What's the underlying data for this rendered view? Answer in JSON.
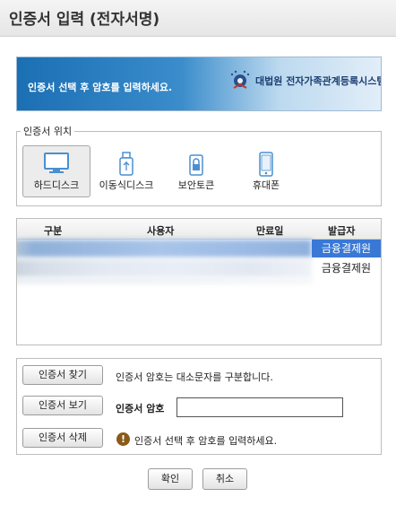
{
  "window": {
    "title": "인증서 입력 (전자서명)"
  },
  "banner": {
    "message": "인증서 선택 후 암호를 입력하세요.",
    "brand": "대법원 전자가족관계등록시스템"
  },
  "location": {
    "legend": "인증서 위치",
    "items": [
      {
        "label": "하드디스크",
        "icon": "monitor-icon",
        "selected": true
      },
      {
        "label": "이동식디스크",
        "icon": "usb-icon",
        "selected": false
      },
      {
        "label": "보안토큰",
        "icon": "lock-token-icon",
        "selected": false
      },
      {
        "label": "휴대폰",
        "icon": "phone-icon",
        "selected": false
      }
    ]
  },
  "table": {
    "headers": [
      "구분",
      "사용자",
      "만료일",
      "발급자"
    ],
    "rows": [
      {
        "issuer": "금융결제원",
        "selected": true
      },
      {
        "issuer": "금융결제원",
        "selected": false
      }
    ]
  },
  "actions": {
    "find": "인증서 찾기",
    "view": "인증서 보기",
    "delete": "인증서 삭제",
    "case_note": "인증서 암호는 대소문자를 구분합니다.",
    "password_label": "인증서 암호",
    "password_value": "",
    "hint": "인증서 선택 후 암호를 입력하세요."
  },
  "footer": {
    "ok": "확인",
    "cancel": "취소"
  },
  "colors": {
    "selection": "#3a78d6",
    "banner": "#1b6fb3",
    "warn": "#8a5a1a"
  }
}
